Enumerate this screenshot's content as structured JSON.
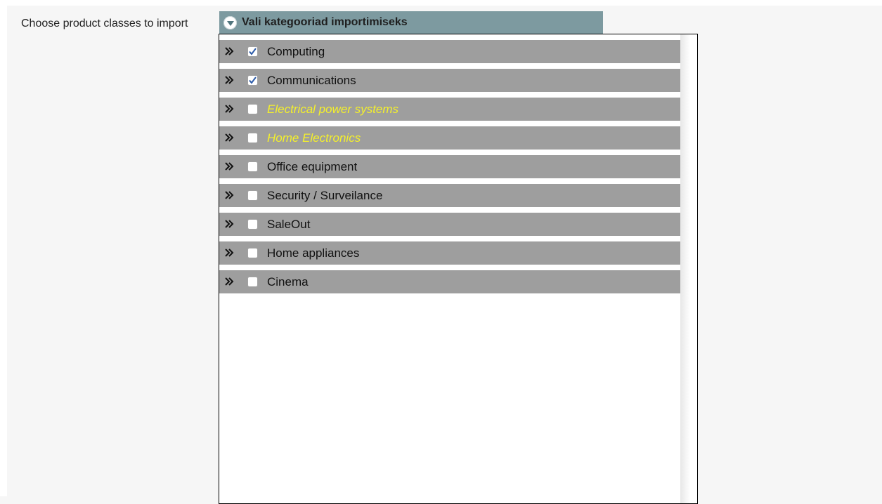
{
  "field": {
    "label": "Choose product classes to import"
  },
  "panel": {
    "title": "Vali kategooriad importimiseks",
    "toggle_icon": "chevron-down-circle-icon",
    "header_color": "#7d9aa0",
    "row_color": "#9e9e9e",
    "highlight_text_color": "#f4f02b"
  },
  "categories": [
    {
      "label": "Computing",
      "checked": true,
      "highlighted": false,
      "expand_icon": "double-chevron-right-icon"
    },
    {
      "label": "Communications",
      "checked": true,
      "highlighted": false,
      "expand_icon": "double-chevron-right-icon"
    },
    {
      "label": "Electrical power systems",
      "checked": false,
      "highlighted": true,
      "expand_icon": "double-chevron-right-icon"
    },
    {
      "label": "Home Electronics",
      "checked": false,
      "highlighted": true,
      "expand_icon": "double-chevron-right-icon"
    },
    {
      "label": "Office equipment",
      "checked": false,
      "highlighted": false,
      "expand_icon": "double-chevron-right-icon"
    },
    {
      "label": "Security / Surveilance",
      "checked": false,
      "highlighted": false,
      "expand_icon": "double-chevron-right-icon"
    },
    {
      "label": "SaleOut",
      "checked": false,
      "highlighted": false,
      "expand_icon": "double-chevron-right-icon"
    },
    {
      "label": "Home appliances",
      "checked": false,
      "highlighted": false,
      "expand_icon": "double-chevron-right-icon"
    },
    {
      "label": "Cinema",
      "checked": false,
      "highlighted": false,
      "expand_icon": "double-chevron-right-icon"
    }
  ]
}
